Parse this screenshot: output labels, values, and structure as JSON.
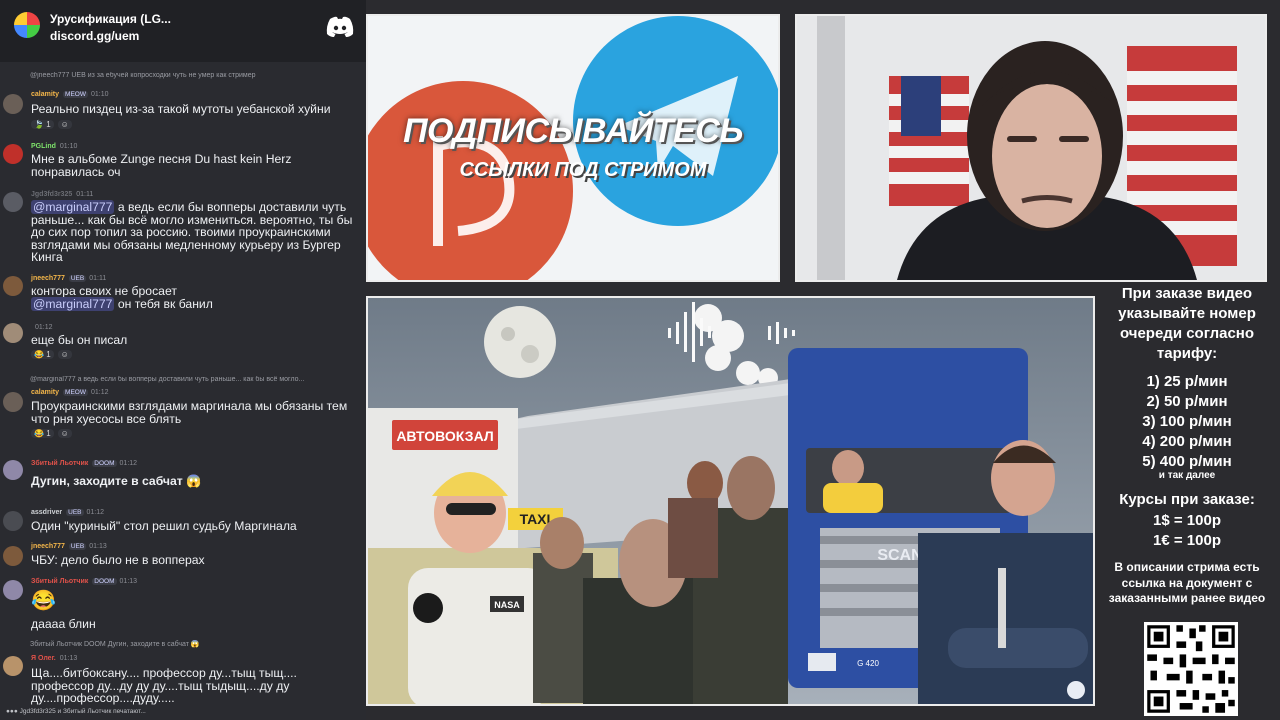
{
  "chat": {
    "server_name": "Урусификация (LG...",
    "server_invite": "discord.gg/uem",
    "typing": "Jgd3fd3r325 и Збитый Льотчик печатают...",
    "messages": [
      {
        "reply": "@jneech777 UEB из за ебучей копросходки чуть не умер как стример",
        "author": "calamity",
        "author_color": "#f4b64a",
        "badges": [
          "MEOW"
        ],
        "time": "01:10",
        "text": "Реально пиздец из-за такой мутоты уебанской хуйни",
        "reactions": [
          "1"
        ]
      },
      {
        "author": "PGLind",
        "author_color": "#7ee36b",
        "badges": [],
        "time": "01:10",
        "text": "Мне в альбоме Zunge песня Du hast kein Herz понравилась оч"
      },
      {
        "author": "Jgd3fd3r325",
        "author_color": "#6b6d74",
        "badges": [],
        "time": "01:11",
        "mention": "@marginal777",
        "text": " а ведь если бы вопперы доставили чуть раньше... как бы всё могло измениться. вероятно, ты бы до сих пор топил за россию. твоими проукраинскими взглядами мы обязаны медленному курьеру из Бургер Кинга"
      },
      {
        "author": "jneech777",
        "author_color": "#f4b64a",
        "badges": [
          "UEB"
        ],
        "time": "01:11",
        "text": "контора своих не бросает",
        "text2_mention": "@marginal777",
        "text2": " он тебя вк банил"
      },
      {
        "author": "",
        "author_color": "#6b6d74",
        "badges": [],
        "time": "01:12",
        "text": "еще бы он писал",
        "reactions": [
          "1"
        ]
      },
      {
        "reply": "@marginal777 а ведь если бы вопперы доставили чуть раньше... как бы всё могло...",
        "author": "calamity",
        "author_color": "#f4b64a",
        "badges": [
          "MEOW"
        ],
        "time": "01:12",
        "text": "Проукраинскими взглядами маргинала мы обязаны тем что рня хуесосы все блять",
        "reactions": [
          "1"
        ]
      },
      {
        "author": "Збитый Льотчик",
        "author_color": "#e0524a",
        "badges": [
          "DOOM"
        ],
        "time": "01:12",
        "text": "Дугин, заходите в сабчат 😱",
        "bold": true
      },
      {
        "author": "assdriver",
        "author_color": "#cfd2d6",
        "badges": [
          "UEB"
        ],
        "time": "01:12",
        "text": "Один \"куриный\" стол решил судьбу Маргинала"
      },
      {
        "author": "jneech777",
        "author_color": "#f4b64a",
        "badges": [
          "UEB"
        ],
        "time": "01:13",
        "text": "ЧБУ: дело было не в вопперах"
      },
      {
        "author": "Збитый Льотчик",
        "author_color": "#e0524a",
        "badges": [
          "DOOM"
        ],
        "time": "01:13",
        "emoji": "😂",
        "text": "даааа блин"
      },
      {
        "reply": "Збитый Льотчик DOOM Дугин, заходите в сабчат 😱",
        "author": "Я Олег.",
        "author_color": "#e0524a",
        "badges": [],
        "time": "01:13",
        "text": "Ща....битбоксану.... профессор ду...тыщ тыщ.... профессор ду...ду ду ду....тыщ тыдыщ....ду ду ду....профессор....дуду....."
      }
    ]
  },
  "promo": {
    "title": "ПОДПИСЫВАЙТЕСЬ",
    "subtitle": "ССЫЛКИ ПОД СТРИМОМ",
    "colors": {
      "boosty": "#d9573b",
      "telegram": "#2aa3df"
    }
  },
  "video": {
    "sign": "АВТОВОКЗАЛ",
    "taxi": "TAXI",
    "truck_brand": "SCANIA",
    "truck_model": "G 420",
    "shirt": "NASA"
  },
  "info": {
    "heading": "При заказе видео указывайте номер очереди согласно тарифу:",
    "tariffs": [
      "1) 25 р/мин",
      "2) 50 р/мин",
      "3) 100 р/мин",
      "4) 200 р/мин",
      "5) 400 р/мин"
    ],
    "tariffs_etc": "и так далее",
    "rates_heading": "Курсы при заказе:",
    "rates": [
      "1$ = 100р",
      "1€ = 100р"
    ],
    "note": "В описании стрима есть ссылка на документ с заказанными ранее видео"
  }
}
